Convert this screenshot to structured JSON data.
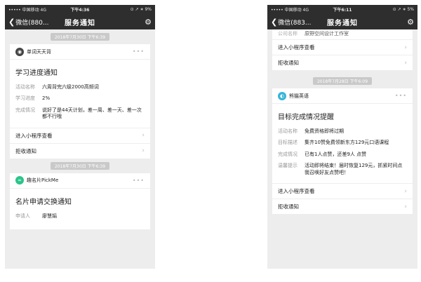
{
  "left": {
    "status": {
      "carrier": "••••• 中国移动  4G",
      "time": "下午4:36",
      "right": "⊙ ↗ ∗ 9%"
    },
    "nav": {
      "back": "微信(880...",
      "title": "服务通知"
    },
    "card1": {
      "time": "2018年7月30日 下午6:39",
      "app_name": "单词天天背",
      "title": "学习进度通知",
      "fields": [
        {
          "k": "活动名称",
          "v": "六周背完六级2000高频词"
        },
        {
          "k": "学习进度",
          "v": "2%"
        },
        {
          "k": "完成情况",
          "v": "说好了是44天计划，差一周、差一天、差一次都不行哦"
        }
      ],
      "action": "进入小程序查看",
      "reject": "拒收通知"
    },
    "card2": {
      "time": "2018年7月30日 下午6:39",
      "app_name": "趣名片PickMe",
      "title": "名片申请交换通知",
      "fields": [
        {
          "k": "申请人",
          "v": "廖慧娟"
        }
      ]
    }
  },
  "right": {
    "status": {
      "carrier": "••••• 中国移动  4G",
      "time": "下午6:11",
      "right": "⊙ ↗ ∗ 5%"
    },
    "nav": {
      "back": "微信(883...",
      "title": "服务通知"
    },
    "fragment": {
      "k": "公司名称",
      "v": "原野空间设计工作室"
    },
    "action_top": "进入小程序查看",
    "reject_top": "拒收通知",
    "card": {
      "time": "2018年7月28日 下午6:09",
      "app_name": "熊猫英语",
      "title": "目标完成情况提醒",
      "fields": [
        {
          "k": "活动名称",
          "v": "免费资格即将过期"
        },
        {
          "k": "目标描述",
          "v": "集齐10赞免费领新东方129元口语课程"
        },
        {
          "k": "完成情况",
          "v": "已有1人点赞，还差9人 点赞"
        },
        {
          "k": "温馨提示",
          "v": "活动即将结束！届时恢复129元，抓紧时间点我召唤好友点赞吧！"
        }
      ],
      "action": "进入小程序查看",
      "reject": "拒收通知"
    }
  },
  "icons": {
    "back": "chevron-left-icon",
    "settings": "gear-icon",
    "more": "more-dots-icon",
    "arrow": "chevron-right-icon"
  },
  "colors": {
    "nav_bg": "#2e2e2e",
    "page_bg": "#ededed",
    "logo_green": "#2bc48a"
  }
}
